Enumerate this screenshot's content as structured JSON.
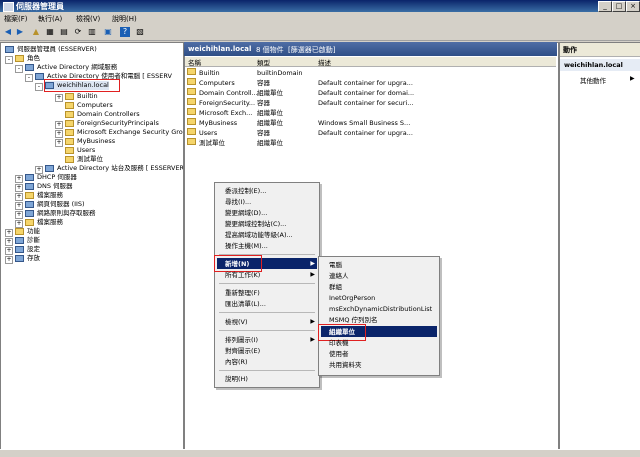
{
  "window": {
    "title": "伺服器管理員"
  },
  "menubar": [
    "檔案(F)",
    "執行(A)",
    "檢視(V)",
    "說明(H)"
  ],
  "tree": {
    "items": [
      {
        "label": "伺服器管理員 (ESSERVER)"
      },
      {
        "label": "角色"
      },
      {
        "label": "Active Directory 網域服務"
      },
      {
        "label": "Active Directory 使用者和電腦 [ ESSERV"
      },
      {
        "label": "weichihlan.local"
      },
      {
        "label": "Builtin"
      },
      {
        "label": "Computers"
      },
      {
        "label": "Domain Controllers"
      },
      {
        "label": "ForeignSecurityPrincipals"
      },
      {
        "label": "Microsoft Exchange Security Group"
      },
      {
        "label": "MyBusiness"
      },
      {
        "label": "Users"
      },
      {
        "label": "測試單位"
      },
      {
        "label": "Active Directory 站台及服務 [ ESSERVER"
      },
      {
        "label": "DHCP 伺服器"
      },
      {
        "label": "DNS 伺服器"
      },
      {
        "label": "檔案服務"
      },
      {
        "label": "網頁伺服器 (IIS)"
      },
      {
        "label": "網路原則與存取服務"
      },
      {
        "label": "檔案服務"
      },
      {
        "label": "功能"
      },
      {
        "label": "診斷"
      },
      {
        "label": "設定"
      },
      {
        "label": "存放"
      }
    ]
  },
  "content": {
    "domain": "weichihlan.local",
    "count": "8 個物件",
    "filter": "[篩選器已啟動]",
    "columns": [
      "名稱",
      "類型",
      "描述"
    ],
    "rows": [
      {
        "name": "Builtin",
        "type": "builtinDomain",
        "desc": ""
      },
      {
        "name": "Computers",
        "type": "容器",
        "desc": "Default container for upgra..."
      },
      {
        "name": "Domain Controll...",
        "type": "組織單位",
        "desc": "Default container for domai..."
      },
      {
        "name": "ForeignSecurity...",
        "type": "容器",
        "desc": "Default container for securi..."
      },
      {
        "name": "Microsoft Exch...",
        "type": "組織單位",
        "desc": ""
      },
      {
        "name": "MyBusiness",
        "type": "組織單位",
        "desc": "Windows Small Business S..."
      },
      {
        "name": "Users",
        "type": "容器",
        "desc": "Default container for upgra..."
      },
      {
        "name": "測試單位",
        "type": "組織單位",
        "desc": ""
      }
    ]
  },
  "actions": {
    "title": "動作",
    "section": "weichihlan.local",
    "more": "其他動作"
  },
  "context_menu": {
    "items": [
      "委派控制(E)...",
      "尋找(I)...",
      "變更網域(D)...",
      "變更網域控制站(C)...",
      "提高網域功能等級(A)...",
      "操作主機(M)..."
    ],
    "new_label": "新增(N)",
    "all_tasks": "所有工作(K)",
    "items2": [
      "重新整理(F)",
      "匯出清單(L)..."
    ],
    "view": "檢視(V)",
    "items3": [
      "排列圖示(I)",
      "對齊圖示(E)",
      "內容(R)"
    ],
    "help": "說明(H)"
  },
  "submenu": {
    "items": [
      "電腦",
      "連絡人",
      "群組",
      "InetOrgPerson",
      "msExchDynamicDistributionList",
      "MSMQ 佇列別名"
    ],
    "selected": "組織單位",
    "items2": [
      "印表機",
      "使用者",
      "共用資料夾"
    ]
  }
}
